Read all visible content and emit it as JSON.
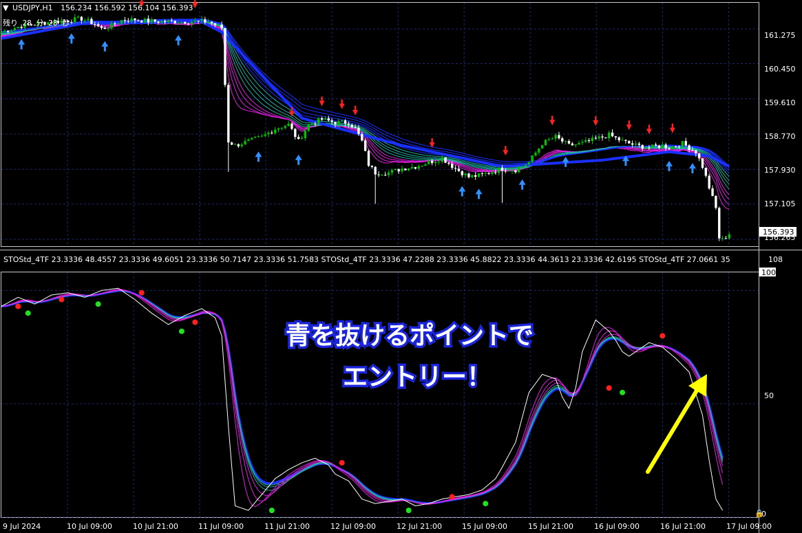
{
  "header": {
    "symbol": "USDJPY,H1",
    "ohlc": "156.234 156.592 156.104 156.393",
    "countdown": "残り 28 分 28 秒"
  },
  "indicator": {
    "label": "STOStd_4TF 23.3336 48.4557 23.3336 49.6051 23.3336 50.7147 23.3336 51.7583   STOStd_4TF 23.3336 47.2288 23.3336 45.8822 23.3336 44.3613 23.3336 42.6195   STOStd_4TF 27.0661 35",
    "scale_max_label": "108",
    "level_100": "100",
    "level_50": "50",
    "level_0": "0"
  },
  "price_axis": {
    "ticks": [
      "161.275",
      "160.450",
      "159.610",
      "158.770",
      "157.930",
      "157.105",
      "156.265"
    ],
    "current_price": "156.393"
  },
  "time_axis": {
    "labels": [
      "9 Jul 2024",
      "10 Jul 09:00",
      "10 Jul 21:00",
      "11 Jul 09:00",
      "11 Jul 21:00",
      "12 Jul 09:00",
      "12 Jul 21:00",
      "15 Jul 09:00",
      "15 Jul 21:00",
      "16 Jul 09:00",
      "16 Jul 21:00",
      "17 Jul 09:00"
    ]
  },
  "annotation": {
    "line1": "青を抜けるポイントで",
    "line2": "エントリー！",
    "arrow_color": "#ffff00"
  },
  "colors": {
    "background": "#000000",
    "grid": "#1c2a6e",
    "bull": "#00c000",
    "bear": "#ffffff",
    "ribbon_blue": "#1a30ff",
    "ribbon_magenta": "#e020e0",
    "ribbon_teal": "#20b0a0",
    "sell_arrow": "#ff2020",
    "buy_arrow": "#3090ff",
    "dot_red": "#ff2020",
    "dot_green": "#20e020"
  },
  "chart_data": [
    {
      "type": "candlestick",
      "title": "USDJPY,H1",
      "ylim": [
        156.1,
        161.9
      ],
      "y_ticks": [
        161.275,
        160.45,
        159.61,
        158.77,
        157.93,
        157.105,
        156.265
      ],
      "anchors": [
        [
          0,
          161.2
        ],
        [
          6,
          161.35
        ],
        [
          12,
          161.42
        ],
        [
          20,
          161.48
        ],
        [
          24,
          161.52
        ],
        [
          28,
          161.4
        ],
        [
          30,
          161.28
        ],
        [
          33,
          161.35
        ],
        [
          36,
          161.48
        ],
        [
          40,
          161.5
        ],
        [
          44,
          161.46
        ],
        [
          48,
          161.45
        ],
        [
          54,
          161.45
        ],
        [
          62,
          161.45
        ],
        [
          66,
          161.3
        ],
        [
          68,
          158.6
        ],
        [
          70,
          158.5
        ],
        [
          74,
          158.6
        ],
        [
          78,
          158.7
        ],
        [
          82,
          158.9
        ],
        [
          86,
          159.0
        ],
        [
          89,
          158.6
        ],
        [
          92,
          159.0
        ],
        [
          96,
          159.12
        ],
        [
          100,
          159.05
        ],
        [
          104,
          159.05
        ],
        [
          106,
          158.9
        ],
        [
          108,
          158.6
        ],
        [
          110,
          158.05
        ],
        [
          112,
          157.85
        ],
        [
          116,
          157.85
        ],
        [
          120,
          157.95
        ],
        [
          124,
          158.0
        ],
        [
          128,
          158.1
        ],
        [
          132,
          158.2
        ],
        [
          136,
          157.95
        ],
        [
          140,
          157.75
        ],
        [
          144,
          157.8
        ],
        [
          148,
          157.9
        ],
        [
          150,
          157.95
        ],
        [
          154,
          157.92
        ],
        [
          158,
          158.1
        ],
        [
          162,
          158.55
        ],
        [
          166,
          158.7
        ],
        [
          170,
          158.5
        ],
        [
          174,
          158.55
        ],
        [
          178,
          158.65
        ],
        [
          182,
          158.75
        ],
        [
          186,
          158.6
        ],
        [
          190,
          158.5
        ],
        [
          194,
          158.45
        ],
        [
          198,
          158.5
        ],
        [
          200,
          158.45
        ],
        [
          204,
          158.55
        ],
        [
          208,
          158.35
        ],
        [
          210,
          158.0
        ],
        [
          212,
          157.5
        ],
        [
          214,
          157.0
        ],
        [
          215,
          156.3
        ],
        [
          216,
          156.25
        ],
        [
          218,
          156.4
        ]
      ],
      "ema_band": [
        [
          0,
          161.1
        ],
        [
          24,
          161.45
        ],
        [
          60,
          161.5
        ],
        [
          66,
          161.25
        ],
        [
          90,
          159.2
        ],
        [
          100,
          158.98
        ],
        [
          120,
          158.55
        ],
        [
          150,
          158.05
        ],
        [
          180,
          158.2
        ],
        [
          200,
          158.4
        ],
        [
          212,
          158.3
        ],
        [
          218,
          158.05
        ]
      ],
      "current_price": 156.393
    },
    {
      "type": "line",
      "title": "STOStd_4TF",
      "ylim": [
        0,
        108
      ],
      "levels": [
        100,
        50,
        0
      ],
      "x": [
        0,
        5,
        10,
        15,
        20,
        25,
        30,
        35,
        40,
        45,
        50,
        55,
        60,
        64,
        66,
        68,
        70,
        74,
        78,
        82,
        86,
        90,
        94,
        98,
        100,
        104,
        108,
        112,
        116,
        120,
        124,
        128,
        132,
        136,
        140,
        144,
        148,
        150,
        154,
        158,
        162,
        166,
        168,
        170,
        172,
        174,
        178,
        182,
        184,
        186,
        188,
        190,
        194,
        198,
        202,
        206,
        210,
        212,
        214,
        216
      ],
      "series": [
        {
          "values": [
            93,
            97,
            94,
            98,
            99,
            97,
            100,
            101,
            96,
            90,
            85,
            89,
            92,
            88,
            80,
            40,
            5,
            3,
            10,
            17,
            21,
            24,
            26,
            23,
            19,
            16,
            8,
            6,
            7,
            8,
            5,
            6,
            8,
            9,
            10,
            12,
            17,
            22,
            33,
            55,
            63,
            61,
            53,
            48,
            57,
            73,
            87,
            82,
            78,
            73,
            71,
            73,
            77,
            75,
            70,
            64,
            45,
            25,
            8,
            3
          ]
        }
      ]
    }
  ]
}
